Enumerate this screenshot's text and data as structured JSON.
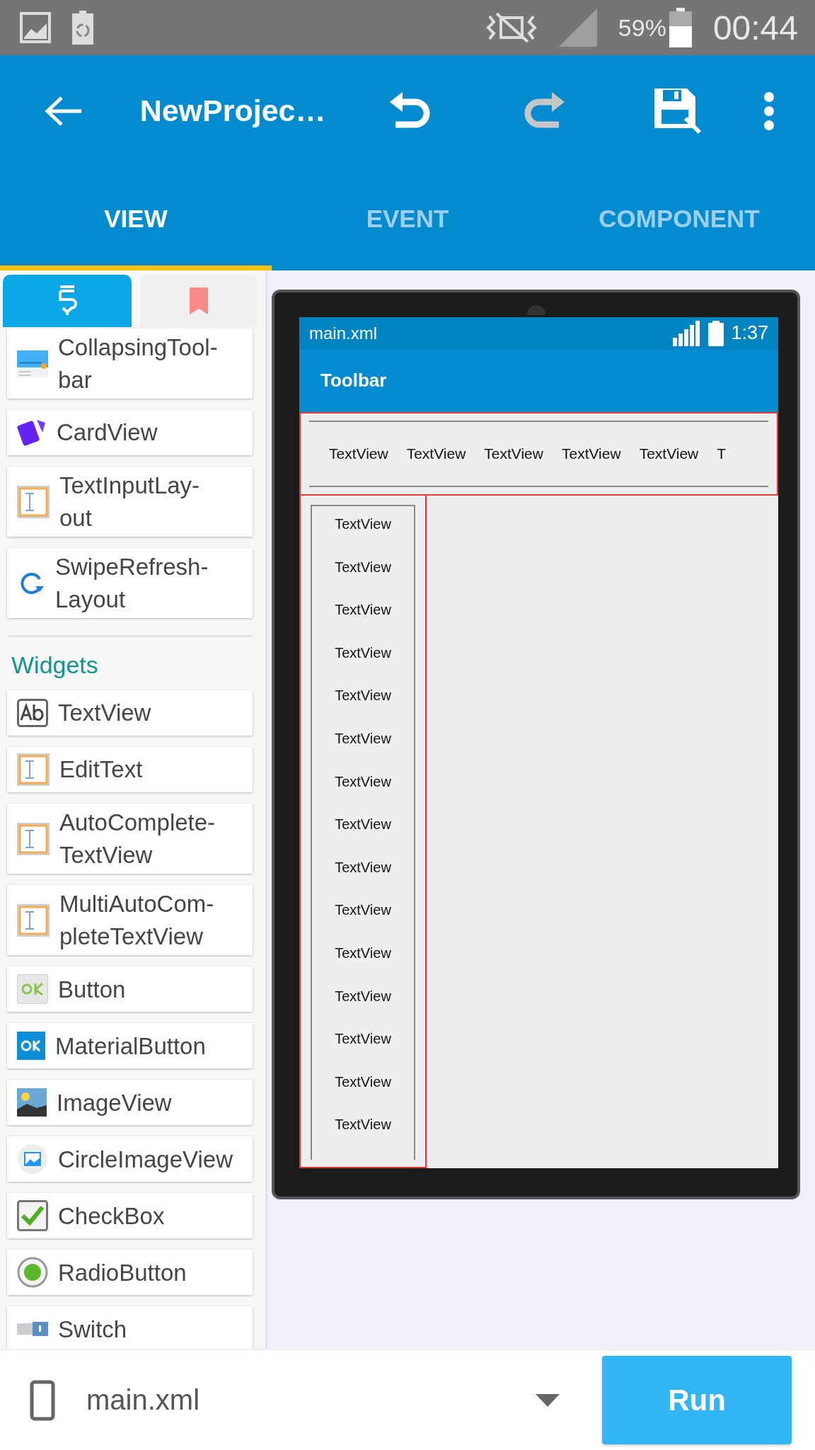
{
  "status_bar": {
    "battery": "59%",
    "time": "00:44"
  },
  "app_bar": {
    "title": "NewProjec…",
    "actions": [
      {
        "kind": "undo",
        "disabled": false
      },
      {
        "kind": "redo",
        "disabled": true
      },
      {
        "kind": "save",
        "disabled": false
      },
      {
        "kind": "more",
        "disabled": false
      }
    ]
  },
  "tabs": [
    {
      "label": "VIEW",
      "selected": true
    },
    {
      "label": "EVENT",
      "selected": false
    },
    {
      "label": "COMPONENT",
      "selected": false
    }
  ],
  "palette": {
    "tabs": [
      {
        "kind": "widgets",
        "selected": true
      },
      {
        "kind": "bookmark",
        "selected": false
      }
    ],
    "sections": [
      {
        "items": [
          {
            "kind": "toolbar",
            "label": "CollapsingTool-\nbar"
          },
          {
            "kind": "card",
            "label": "CardView"
          },
          {
            "kind": "input",
            "label": "TextInputLay-\nout"
          },
          {
            "kind": "refresh",
            "label": "SwipeRefresh-\nLayout"
          }
        ]
      },
      {
        "title": "Widgets",
        "items": [
          {
            "kind": "text",
            "label": "TextView"
          },
          {
            "kind": "input",
            "label": "EditText"
          },
          {
            "kind": "input",
            "label": "AutoComplete-\nTextView"
          },
          {
            "kind": "input",
            "label": "MultiAutoCom-\npleteTextView"
          },
          {
            "kind": "button",
            "label": "Button"
          },
          {
            "kind": "material-button",
            "label": "MaterialButton"
          },
          {
            "kind": "image",
            "label": "ImageView"
          },
          {
            "kind": "circle-image",
            "label": "CircleImageView"
          },
          {
            "kind": "checkbox",
            "label": "CheckBox"
          },
          {
            "kind": "radio",
            "label": "RadioButton"
          },
          {
            "kind": "switch",
            "label": "Switch"
          }
        ]
      }
    ]
  },
  "preview": {
    "status_title": "main.xml",
    "time": "1:37",
    "toolbar_title": "Toolbar",
    "row_items": [
      "TextView",
      "TextView",
      "TextView",
      "TextView",
      "TextView",
      "T"
    ],
    "column_items": [
      "TextView",
      "TextView",
      "TextView",
      "TextView",
      "TextView",
      "TextView",
      "TextView",
      "TextView",
      "TextView",
      "TextView",
      "TextView",
      "TextView",
      "TextView",
      "TextView",
      "TextView"
    ]
  },
  "bottom_bar": {
    "file": "main.xml",
    "run": "Run"
  }
}
